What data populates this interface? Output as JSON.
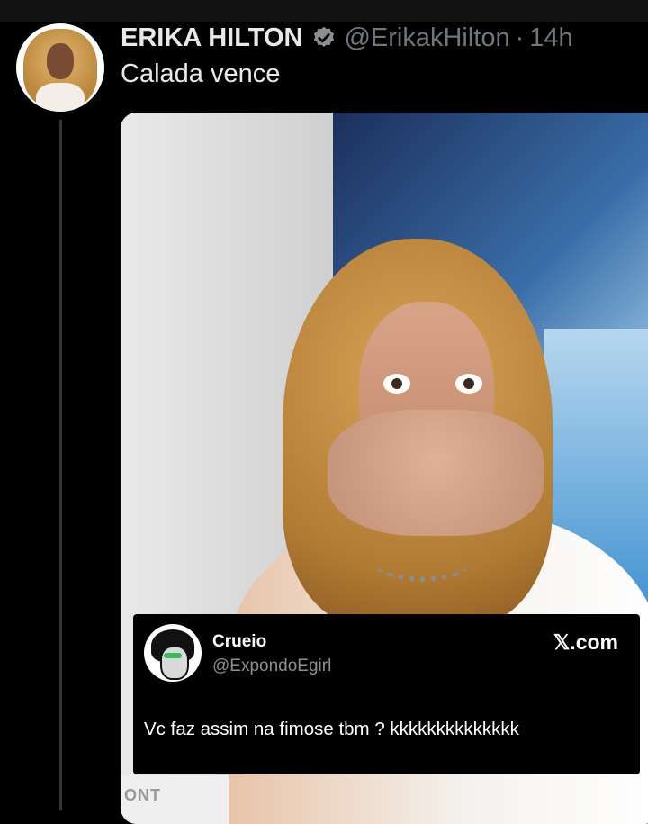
{
  "tweet": {
    "author_name": "ERIKA HILTON",
    "handle": "@ErikakHilton",
    "separator": "·",
    "time": "14h",
    "text": "Calada vence"
  },
  "photo": {
    "sign_text": "ONT"
  },
  "quoted_card": {
    "name": "Crueio",
    "handle": "@ExpondoEgirl",
    "brand": "𝕏.com",
    "text": "Vc faz assim na fimose tbm ? kkkkkkkkkkkkkk"
  },
  "colors": {
    "background": "#000000",
    "verified_badge": "#8b8f93",
    "secondary_text": "#71767b"
  },
  "icons": {
    "verified": "verified-badge-icon"
  }
}
